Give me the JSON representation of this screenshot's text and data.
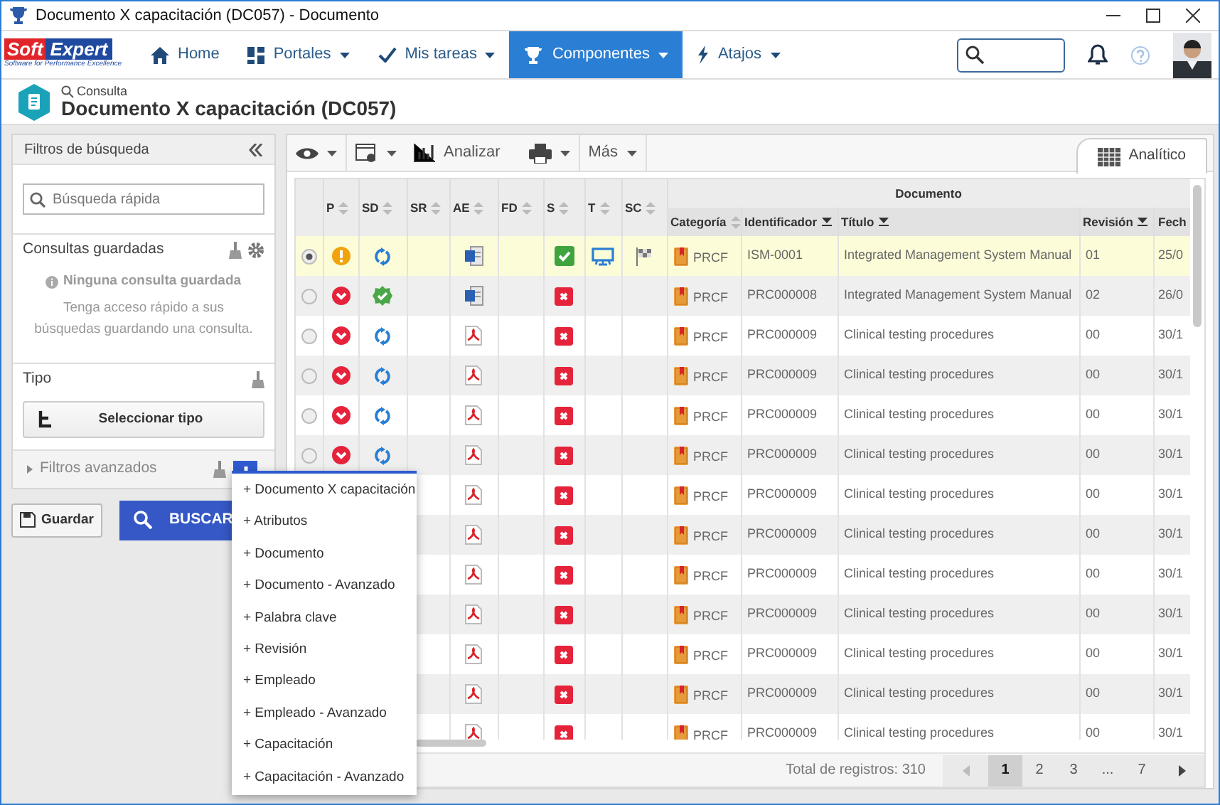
{
  "window": {
    "title": "Documento X capacitación (DC057) - Documento"
  },
  "logo": {
    "left": "Soft",
    "right": "Expert",
    "tagline": "Software for Performance Excellence"
  },
  "nav": [
    {
      "label": "Home",
      "selected": false,
      "dropdown": false
    },
    {
      "label": "Portales",
      "selected": false,
      "dropdown": true
    },
    {
      "label": "Mis tareas",
      "selected": false,
      "dropdown": true
    },
    {
      "label": "Componentes",
      "selected": true,
      "dropdown": true
    },
    {
      "label": "Atajos",
      "selected": false,
      "dropdown": true
    }
  ],
  "header": {
    "breadcrumb": "Consulta",
    "title": "Documento X capacitación (DC057)"
  },
  "filters": {
    "title": "Filtros de búsqueda",
    "search_placeholder": "Búsqueda rápida",
    "saved_title": "Consultas guardadas",
    "saved_empty": "Ninguna consulta guardada",
    "saved_hint": "Tenga acceso rápido a sus búsquedas guardando una consulta.",
    "type_title": "Tipo",
    "type_button": "Seleccionar tipo",
    "advanced": "Filtros avanzados",
    "advanced_expanded": false
  },
  "save_button": "Guardar",
  "search_button": "BUSCAR",
  "toolbar": {
    "analyze": "Analizar",
    "more": "Más"
  },
  "view_tabs": [
    {
      "label": "Analítico",
      "selected": true
    }
  ],
  "table": {
    "group_header": "Documento",
    "columns": [
      {
        "label": "P",
        "sorted": false
      },
      {
        "label": "SD",
        "sorted": false
      },
      {
        "label": "SR",
        "sorted": false
      },
      {
        "label": "AE",
        "sorted": false
      },
      {
        "label": "FD",
        "sorted": false
      },
      {
        "label": "S",
        "sorted": false
      },
      {
        "label": "T",
        "sorted": false
      },
      {
        "label": "SC",
        "sorted": false
      },
      {
        "label": "Categoría",
        "sorted": false
      },
      {
        "label": "Identificador",
        "sorted": true
      },
      {
        "label": "Título",
        "sorted": true
      },
      {
        "label": "Revisión",
        "sorted": true
      },
      {
        "label": "Fech"
      }
    ],
    "rows": [
      {
        "selected": true,
        "p": {
          "kind": "warning"
        },
        "sd": {
          "kind": "sync"
        },
        "ae": {
          "kind": "word"
        },
        "s": {
          "kind": "check"
        },
        "t": {
          "kind": "monitor"
        },
        "sc": {
          "kind": "flag"
        },
        "categoria": "PRCF",
        "identificador": "ISM-0001",
        "titulo": "Integrated Management System Manual",
        "revision": "01",
        "fecha": "25/0"
      },
      {
        "selected": false,
        "p": {
          "kind": "down"
        },
        "sd": {
          "kind": "approved"
        },
        "ae": {
          "kind": "word"
        },
        "s": {
          "kind": "x"
        },
        "categoria": "PRCF",
        "identificador": "PRC000008",
        "titulo": "Integrated Management System Manual",
        "revision": "02",
        "fecha": "26/0"
      },
      {
        "selected": false,
        "p": {
          "kind": "down"
        },
        "sd": {
          "kind": "sync"
        },
        "ae": {
          "kind": "pdf"
        },
        "s": {
          "kind": "x"
        },
        "categoria": "PRCF",
        "identificador": "PRC000009",
        "titulo": "Clinical testing procedures",
        "revision": "00",
        "fecha": "30/1"
      },
      {
        "selected": false,
        "p": {
          "kind": "down"
        },
        "sd": {
          "kind": "sync"
        },
        "ae": {
          "kind": "pdf"
        },
        "s": {
          "kind": "x"
        },
        "categoria": "PRCF",
        "identificador": "PRC000009",
        "titulo": "Clinical testing procedures",
        "revision": "00",
        "fecha": "30/1"
      },
      {
        "selected": false,
        "p": {
          "kind": "down"
        },
        "sd": {
          "kind": "sync"
        },
        "ae": {
          "kind": "pdf"
        },
        "s": {
          "kind": "x"
        },
        "categoria": "PRCF",
        "identificador": "PRC000009",
        "titulo": "Clinical testing procedures",
        "revision": "00",
        "fecha": "30/1"
      },
      {
        "selected": false,
        "p": {
          "kind": "down"
        },
        "sd": {
          "kind": "sync"
        },
        "ae": {
          "kind": "pdf"
        },
        "s": {
          "kind": "x"
        },
        "categoria": "PRCF",
        "identificador": "PRC000009",
        "titulo": "Clinical testing procedures",
        "revision": "00",
        "fecha": "30/1"
      },
      {
        "selected": false,
        "ae": {
          "kind": "pdf"
        },
        "s": {
          "kind": "x"
        },
        "categoria": "PRCF",
        "identificador": "PRC000009",
        "titulo": "Clinical testing procedures",
        "revision": "00",
        "fecha": "30/1"
      },
      {
        "selected": false,
        "ae": {
          "kind": "pdf"
        },
        "s": {
          "kind": "x"
        },
        "categoria": "PRCF",
        "identificador": "PRC000009",
        "titulo": "Clinical testing procedures",
        "revision": "00",
        "fecha": "30/1"
      },
      {
        "selected": false,
        "ae": {
          "kind": "pdf"
        },
        "s": {
          "kind": "x"
        },
        "categoria": "PRCF",
        "identificador": "PRC000009",
        "titulo": "Clinical testing procedures",
        "revision": "00",
        "fecha": "30/1"
      },
      {
        "selected": false,
        "ae": {
          "kind": "pdf"
        },
        "s": {
          "kind": "x"
        },
        "categoria": "PRCF",
        "identificador": "PRC000009",
        "titulo": "Clinical testing procedures",
        "revision": "00",
        "fecha": "30/1"
      },
      {
        "selected": false,
        "ae": {
          "kind": "pdf"
        },
        "s": {
          "kind": "x"
        },
        "categoria": "PRCF",
        "identificador": "PRC000009",
        "titulo": "Clinical testing procedures",
        "revision": "00",
        "fecha": "30/1"
      },
      {
        "selected": false,
        "ae": {
          "kind": "pdf"
        },
        "s": {
          "kind": "x"
        },
        "categoria": "PRCF",
        "identificador": "PRC000009",
        "titulo": "Clinical testing procedures",
        "revision": "00",
        "fecha": "30/1"
      },
      {
        "selected": false,
        "ae": {
          "kind": "pdf"
        },
        "s": {
          "kind": "x"
        },
        "categoria": "PRCF",
        "identificador": "PRC000009",
        "titulo": "Clinical testing procedures",
        "revision": "00",
        "fecha": "30/1"
      }
    ]
  },
  "footer": {
    "total": "Total de registros: 310",
    "pages": [
      {
        "label": "1",
        "selected": true
      },
      {
        "label": "2",
        "selected": false
      },
      {
        "label": "3",
        "selected": false
      },
      {
        "label": "...",
        "selected": false
      },
      {
        "label": "7",
        "selected": false
      }
    ]
  },
  "add_menu": {
    "items": [
      "+ Documento X capacitación",
      "+ Atributos",
      "+ Documento",
      "+ Documento - Avanzado",
      "+ Palabra clave",
      "+ Revisión",
      "+ Empleado",
      "+ Empleado - Avanzado",
      "+ Capacitación",
      "+ Capacitación - Avanzado"
    ]
  }
}
